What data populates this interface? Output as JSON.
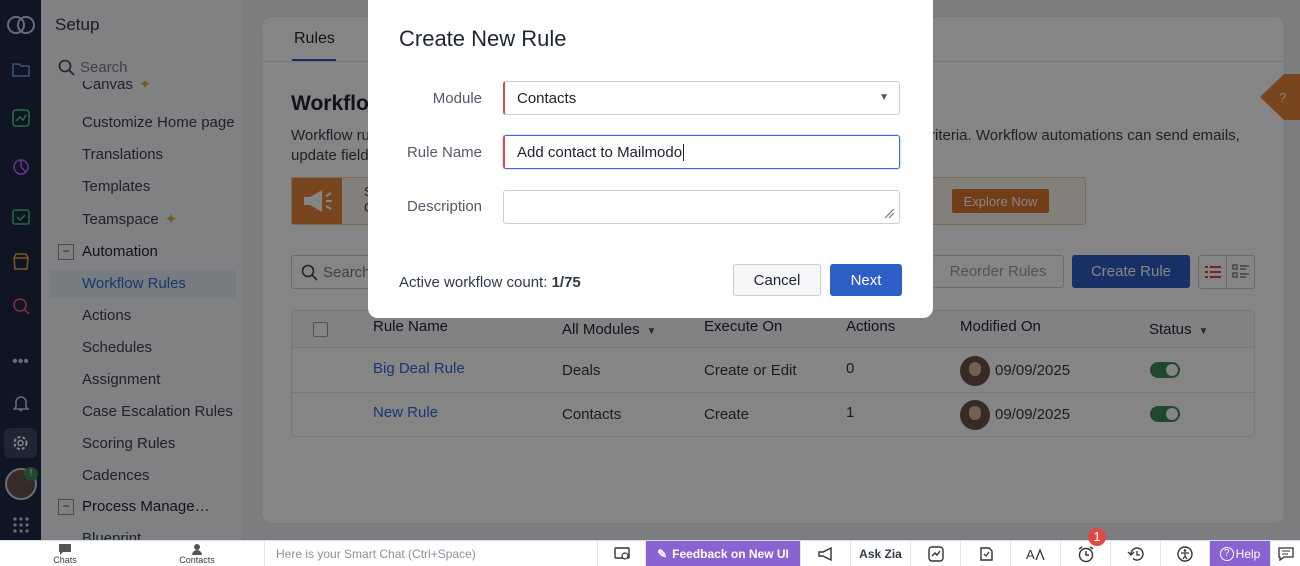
{
  "setup": {
    "title": "Setup",
    "search_placeholder": "Search",
    "items": [
      {
        "label": "Canvas"
      },
      {
        "label": "Customize Home page"
      },
      {
        "label": "Translations"
      },
      {
        "label": "Templates"
      },
      {
        "label": "Teamspace"
      }
    ],
    "automation": {
      "header": "Automation",
      "items": [
        {
          "label": "Workflow Rules"
        },
        {
          "label": "Actions"
        },
        {
          "label": "Schedules"
        },
        {
          "label": "Assignment"
        },
        {
          "label": "Case Escalation Rules"
        },
        {
          "label": "Scoring Rules"
        },
        {
          "label": "Cadences"
        }
      ]
    },
    "process": {
      "header": "Process Management",
      "items": [
        {
          "label": "Blueprint"
        }
      ]
    }
  },
  "main": {
    "tab": "Rules",
    "heading": "Workflow Rules",
    "desc_line1_start": "Workflow ru",
    "desc_line1_end": "riteria. Workflow automations can send emails,",
    "desc_line2": "update field",
    "banner_partial": "S\nC",
    "explore_button": "Explore Now",
    "search_placeholder": "Search",
    "reorder_button": "Reorder Rules",
    "create_rule_button": "Create Rule",
    "table": {
      "headers": {
        "rule_name": "Rule Name",
        "module": "All Modules",
        "execute_on": "Execute On",
        "actions": "Actions",
        "modified_on": "Modified On",
        "status": "Status"
      },
      "rows": [
        {
          "rule_name": "Big Deal Rule",
          "module": "Deals",
          "execute_on": "Create or Edit",
          "actions": "0",
          "modified_on": "09/09/2025",
          "status": "on"
        },
        {
          "rule_name": "New Rule",
          "module": "Contacts",
          "execute_on": "Create",
          "actions": "1",
          "modified_on": "09/09/2025",
          "status": "on"
        }
      ]
    }
  },
  "modal": {
    "title": "Create New Rule",
    "module_label": "Module",
    "module_value": "Contacts",
    "rule_name_label": "Rule Name",
    "rule_name_value": "Add contact to Mailmodo",
    "description_label": "Description",
    "description_value": "",
    "count_label": "Active workflow count:",
    "count_value": "1/75",
    "cancel_button": "Cancel",
    "next_button": "Next"
  },
  "bottombar": {
    "chats": "Chats",
    "contacts": "Contacts",
    "smart_chat_placeholder": "Here is your Smart Chat (Ctrl+Space)",
    "feedback": "Feedback on New UI",
    "ask_zia": "Ask Zia",
    "alarm_badge": "1",
    "help": "Help"
  },
  "rail": {
    "avatar_badge": "!"
  },
  "colors": {
    "rail": "#1f2a44",
    "accent": "#2d5fc6",
    "orange": "#e8853b",
    "feedback": "#8a63d2",
    "toggle": "#3c8b5a"
  }
}
